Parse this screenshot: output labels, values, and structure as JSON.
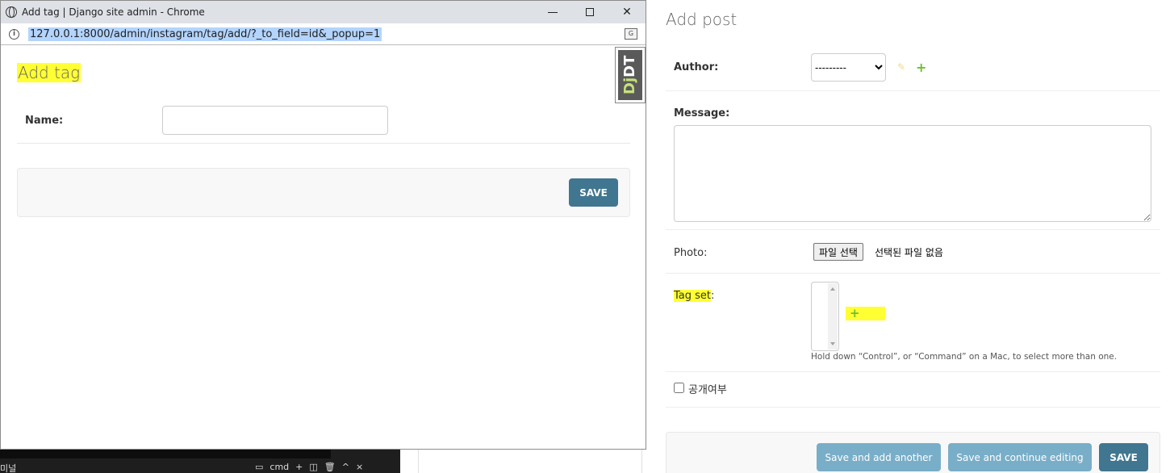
{
  "popup": {
    "window_title": "Add tag | Django site admin - Chrome",
    "url": "127.0.0.1:8000/admin/instagram/tag/add/?_to_field=id&_popup=1",
    "close_glyph": "✕",
    "djdt": {
      "prefix": "Dj",
      "suffix": "DT"
    },
    "heading": "Add tag",
    "name_label": "Name:",
    "name_value": "",
    "save_label": "SAVE"
  },
  "main": {
    "heading": "Add post",
    "author": {
      "label": "Author:",
      "selected": "---------"
    },
    "message": {
      "label": "Message:",
      "value": ""
    },
    "photo": {
      "label": "Photo:",
      "button": "파일 선택",
      "status": "선택된 파일 없음"
    },
    "tags": {
      "label": "Tag set",
      "colon": ":",
      "help": "Hold down “Control”, or “Command” on a Mac, to select more than one."
    },
    "public": {
      "label": "공개여부",
      "checked": false
    },
    "buttons": {
      "save_add_another": "Save and add another",
      "save_continue": "Save and continue editing",
      "save": "SAVE"
    }
  },
  "terminal": {
    "label": "미널",
    "cmd": "cmd"
  },
  "icons": {
    "pencil": "pencil-icon",
    "plus": "plus-icon",
    "info": "info-icon",
    "translate": "translate-icon",
    "accent_plus_color": "#70bf2b",
    "save_color": "#417690",
    "light_button_color": "#79aec8",
    "highlight_color": "#ffff33"
  }
}
